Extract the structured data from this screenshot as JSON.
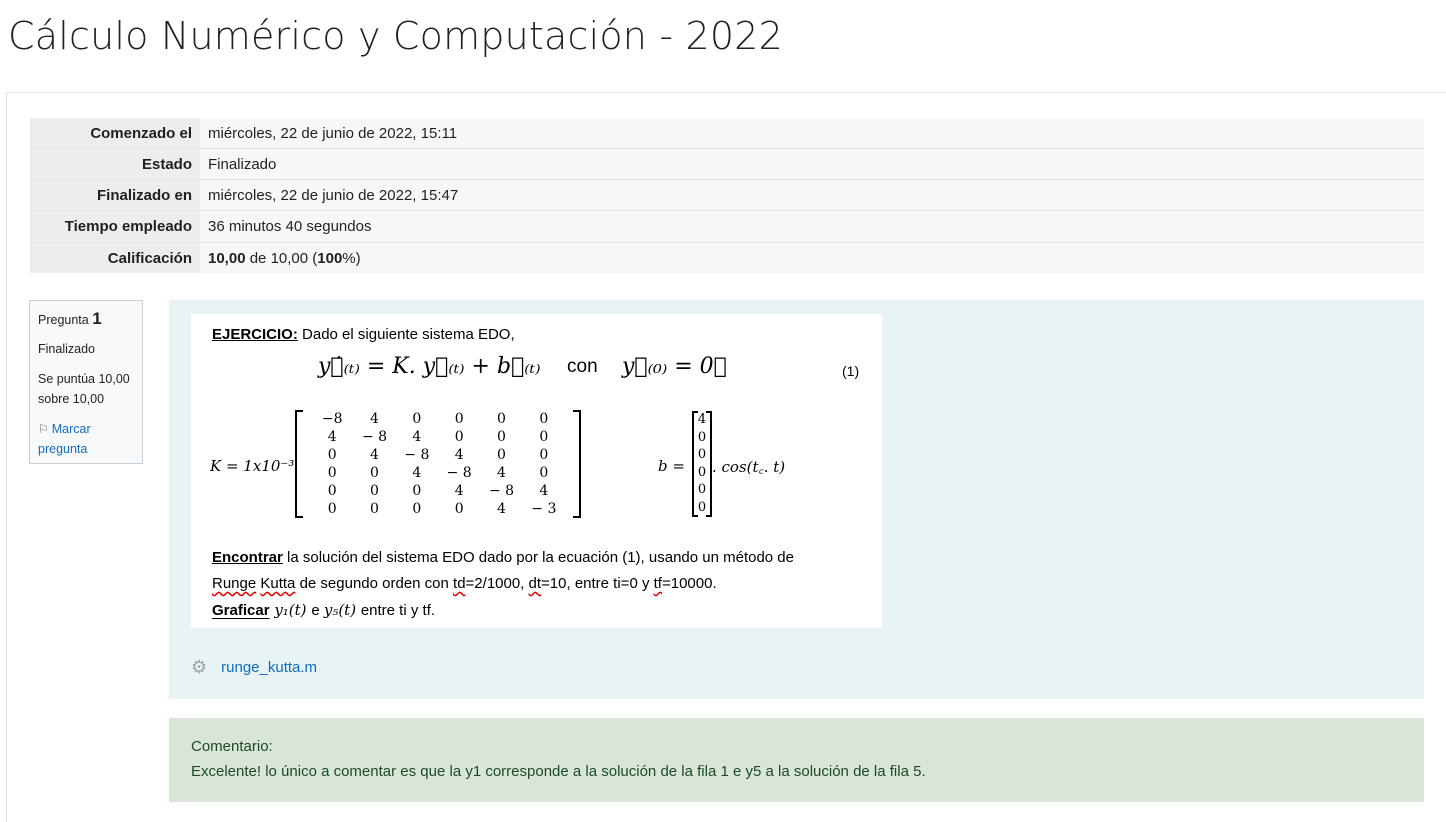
{
  "page": {
    "title": "Cálculo Numérico y Computación - 2022"
  },
  "summary": {
    "rows": [
      {
        "label": "Comenzado el",
        "value": "miércoles, 22 de junio de 2022, 15:11"
      },
      {
        "label": "Estado",
        "value": "Finalizado"
      },
      {
        "label": "Finalizado en",
        "value": "miércoles, 22 de junio de 2022, 15:47"
      },
      {
        "label": "Tiempo empleado",
        "value": "36 minutos 40 segundos"
      },
      {
        "label": "Calificación",
        "grade": "10,00",
        "grade_of": " de 10,00 (",
        "percent": "100",
        "percent_close": "%)"
      }
    ]
  },
  "question": {
    "label": "Pregunta",
    "number": "1",
    "state": "Finalizado",
    "grade_text": "Se puntúa 10,00 sobre 10,00",
    "flag_label": "Marcar pregunta",
    "flag_icon": "flag-icon"
  },
  "exercise": {
    "heading": "EJERCICIO:",
    "intro": " Dado el siguiente sistema EDO,",
    "equation": "y⃗̇₍ₜ₎ = K. y⃗₍ₜ₎ + b⃗₍ₜ₎",
    "con": "con",
    "initial": "y⃗₍₀₎ = 0⃗",
    "eq_number": "(1)",
    "k_label": "K = 1x10⁻³",
    "k_matrix": [
      [
        "−8",
        "4",
        "0",
        "0",
        "0",
        "0"
      ],
      [
        "4",
        "− 8",
        "4",
        "0",
        "0",
        "0"
      ],
      [
        "0",
        "4",
        "− 8",
        "4",
        "0",
        "0"
      ],
      [
        "0",
        "0",
        "4",
        "− 8",
        "4",
        "0"
      ],
      [
        "0",
        "0",
        "0",
        "4",
        "− 8",
        "4"
      ],
      [
        "0",
        "0",
        "0",
        "0",
        "4",
        "− 3"
      ]
    ],
    "b_label": "b =",
    "b_vector": [
      "4",
      "0",
      "0",
      "0",
      "0",
      "0"
    ],
    "b_cos": ". cos(t꜀. t)",
    "line1_bold": "Encontrar",
    "line1_rest": " la solución del sistema EDO dado por la ecuación (1), usando un método de",
    "line2_a": "Runge",
    "line2_b": "Kutta",
    "line2_c": " de segundo orden con ",
    "line2_td": "td",
    "line2_d": "=2/1000, ",
    "line2_dt": "dt",
    "line2_e": "=10, entre ti=0 y ",
    "line2_tf": "tf",
    "line2_f": "=10000.",
    "line3_bold": "Graficar",
    "line3_y1": " y₁(t) ",
    "line3_e": " e ",
    "line3_y5": " y₅(t) ",
    "line3_rest": "  entre ti y tf."
  },
  "attachment": {
    "name": "runge_kutta.m",
    "icon": "gear-icon"
  },
  "feedback": {
    "label": "Comentario:",
    "text": "Excelente! lo único a comentar es que la y1 corresponde a la solución de la fila 1 e y5 a la solución de la fila 5."
  }
}
